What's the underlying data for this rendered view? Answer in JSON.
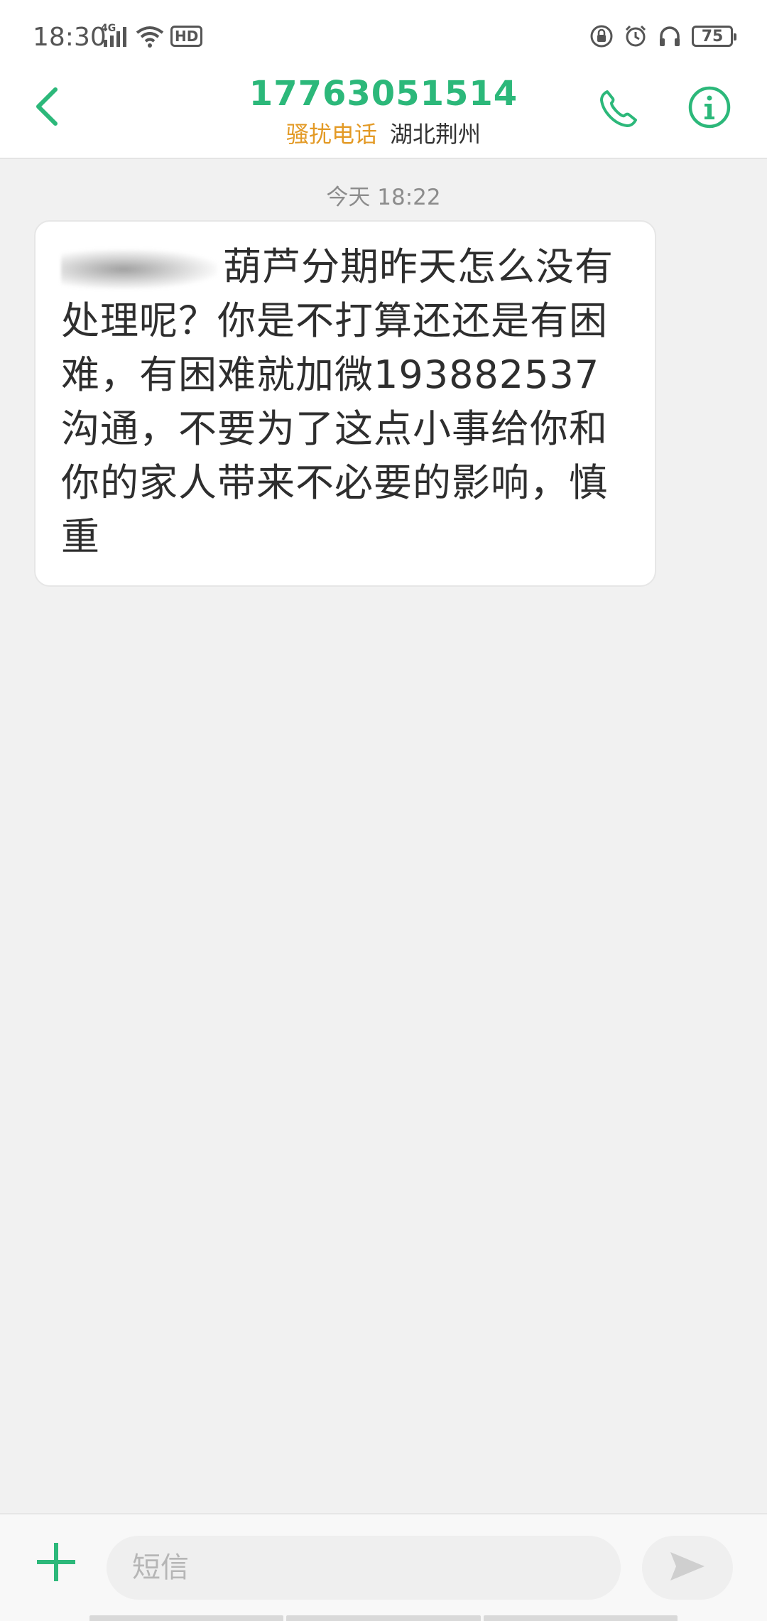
{
  "status_bar": {
    "time": "18:30",
    "network": "4G",
    "hd": "HD",
    "battery": "75",
    "left_icons": [
      "signal-icon",
      "wifi-icon",
      "hd-icon"
    ],
    "right_icons": [
      "lock-rotation-icon",
      "alarm-icon",
      "headphones-icon",
      "battery-icon"
    ]
  },
  "header": {
    "contact_number": "17763051514",
    "spam_tag": "骚扰电话",
    "location": "湖北荆州",
    "icons": [
      "back-arrow-icon",
      "phone-icon",
      "info-icon"
    ]
  },
  "conversation": {
    "timestamp": "今天 18:22",
    "message": {
      "text": "葫芦分期昨天怎么没有处理呢？你是不打算还还是有困难，有困难就加微193882537沟通，不要为了这点小事给你和你的家人带来不必要的影响，慎重"
    }
  },
  "input_bar": {
    "placeholder": "短信",
    "value": "",
    "icons": [
      "plus-icon",
      "send-icon"
    ]
  },
  "colors": {
    "accent": "#2cb87a",
    "spam": "#e39a26",
    "background": "#f1f1f1"
  }
}
